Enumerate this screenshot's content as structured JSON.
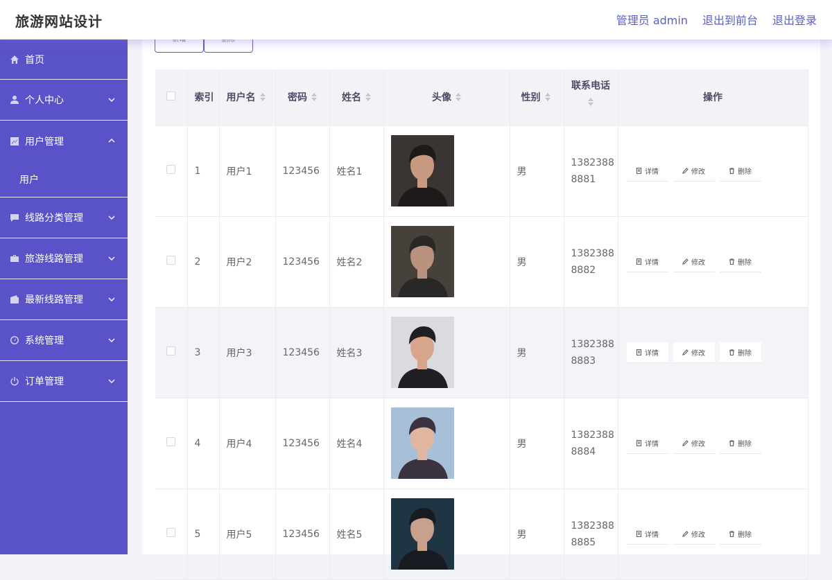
{
  "app": {
    "title": "旅游网站设计",
    "admin_label": "管理员 admin",
    "to_frontend": "退出到前台",
    "logout": "退出登录"
  },
  "colors": {
    "accent": "#5a52c8",
    "link": "#5a5fc4"
  },
  "sidebar": {
    "items": [
      {
        "label": "首页",
        "icon": "home-icon"
      },
      {
        "label": "个人中心",
        "icon": "user-icon"
      },
      {
        "label": "用户管理",
        "icon": "chart-icon",
        "open": true,
        "sub": "用户"
      },
      {
        "label": "线路分类管理",
        "icon": "chat-icon"
      },
      {
        "label": "旅游线路管理",
        "icon": "briefcase-icon"
      },
      {
        "label": "最新线路管理",
        "icon": "wallet-icon"
      },
      {
        "label": "系统管理",
        "icon": "gauge-icon"
      },
      {
        "label": "订单管理",
        "icon": "power-icon"
      }
    ]
  },
  "toolbar": {
    "add_label": "新增",
    "delete_label": "删除"
  },
  "table": {
    "headers": {
      "index": "索引",
      "username": "用户名",
      "password": "密码",
      "name": "姓名",
      "avatar": "头像",
      "gender": "性别",
      "phone": "联系电话",
      "actions": "操作"
    },
    "action_labels": {
      "detail": "详情",
      "edit": "修改",
      "delete": "删除"
    },
    "rows": [
      {
        "index": "1",
        "username": "用户1",
        "password": "123456",
        "name": "姓名1",
        "gender": "男",
        "phone1": "1382388",
        "phone2": "8881"
      },
      {
        "index": "2",
        "username": "用户2",
        "password": "123456",
        "name": "姓名2",
        "gender": "男",
        "phone1": "1382388",
        "phone2": "8882"
      },
      {
        "index": "3",
        "username": "用户3",
        "password": "123456",
        "name": "姓名3",
        "gender": "男",
        "phone1": "1382388",
        "phone2": "8883"
      },
      {
        "index": "4",
        "username": "用户4",
        "password": "123456",
        "name": "姓名4",
        "gender": "男",
        "phone1": "1382388",
        "phone2": "8884"
      },
      {
        "index": "5",
        "username": "用户5",
        "password": "123456",
        "name": "姓名5",
        "gender": "男",
        "phone1": "1382388",
        "phone2": "8885"
      }
    ]
  }
}
